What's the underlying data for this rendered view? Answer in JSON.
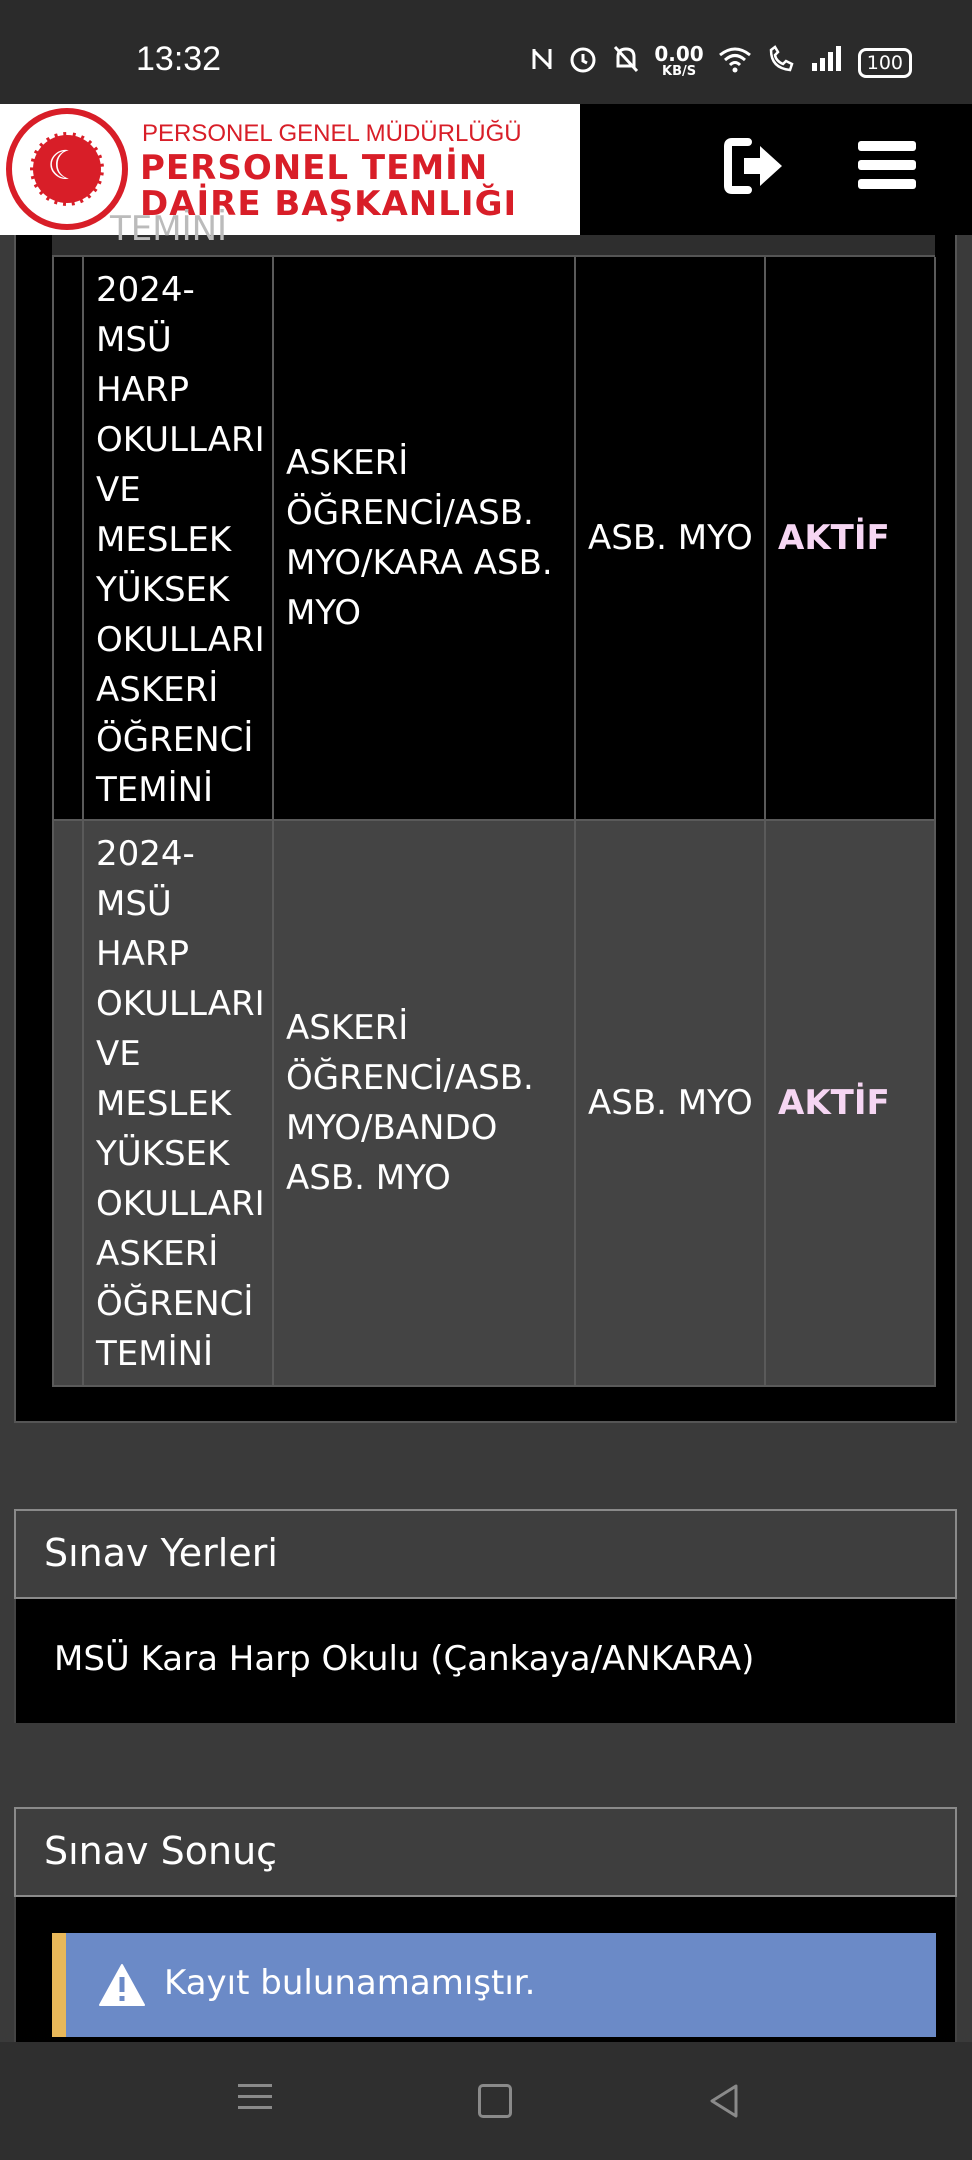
{
  "status_bar": {
    "time": "13:32",
    "speed_value": "0.00",
    "speed_unit": "KB/S",
    "battery": "100",
    "icons": [
      "nfc-icon",
      "alarm-icon",
      "mute-icon",
      "wifi-icon",
      "wifi-calling-icon",
      "signal-icon",
      "battery-icon"
    ]
  },
  "header": {
    "logo_line1": "PERSONEL GENEL MÜDÜRLÜĞÜ",
    "logo_line2": "PERSONEL TEMİN",
    "logo_line3": "DAİRE BAŞKANLIĞI",
    "brand_color": "#d81e28",
    "icons": [
      "logout-icon",
      "menu-icon"
    ]
  },
  "table": {
    "partial_row_text": "TEMİNİ",
    "rows": [
      {
        "exam": "2024-MSÜ HARP OKULLARI VE MESLEK YÜKSEK OKULLARI ASKERİ ÖĞRENCİ TEMİNİ",
        "category": "ASKERİ ÖĞRENCİ/ASB. MYO/KARA ASB. MYO",
        "type": "ASB. MYO",
        "status": "AKTİF"
      },
      {
        "exam": "2024-MSÜ HARP OKULLARI VE MESLEK YÜKSEK OKULLARI ASKERİ ÖĞRENCİ TEMİNİ",
        "category": "ASKERİ ÖĞRENCİ/ASB. MYO/BANDO ASB. MYO",
        "type": "ASB. MYO",
        "status": "AKTİF"
      }
    ]
  },
  "sinav_yerleri": {
    "title": "Sınav Yerleri",
    "location": "MSÜ Kara Harp Okulu (Çankaya/ANKARA)"
  },
  "sinav_sonuc": {
    "title": "Sınav Sonuç",
    "alert": "Kayıt bulunamamıştır."
  },
  "nav_bar": {
    "icons": [
      "recent-apps-icon",
      "home-icon",
      "back-icon"
    ]
  }
}
